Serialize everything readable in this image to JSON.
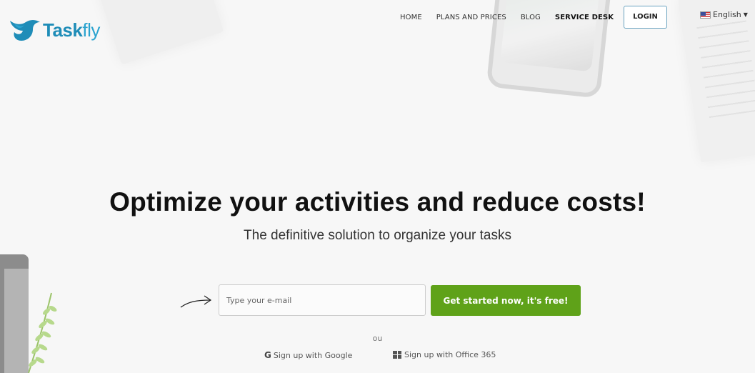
{
  "brand": {
    "name_bold": "Task",
    "name_light": "fly",
    "color": "#1f8db8"
  },
  "nav": {
    "items": [
      {
        "label": "HOME"
      },
      {
        "label": "PLANS AND PRICES"
      },
      {
        "label": "BLOG"
      },
      {
        "label": "SERVICE DESK"
      }
    ],
    "login_label": "LOGIN"
  },
  "language": {
    "selected": "English",
    "flag_icon": "us-flag-icon"
  },
  "hero": {
    "title": "Optimize your activities and reduce costs!",
    "subtitle": "The definitive solution to organize your tasks"
  },
  "signup_form": {
    "email_placeholder": "Type your e-mail",
    "email_value": "",
    "cta_label": "Get started now, it's free!",
    "cta_color": "#5fa219",
    "separator": "ou",
    "google_label": "Sign up with Google",
    "office_label": "Sign up with Office 365"
  }
}
